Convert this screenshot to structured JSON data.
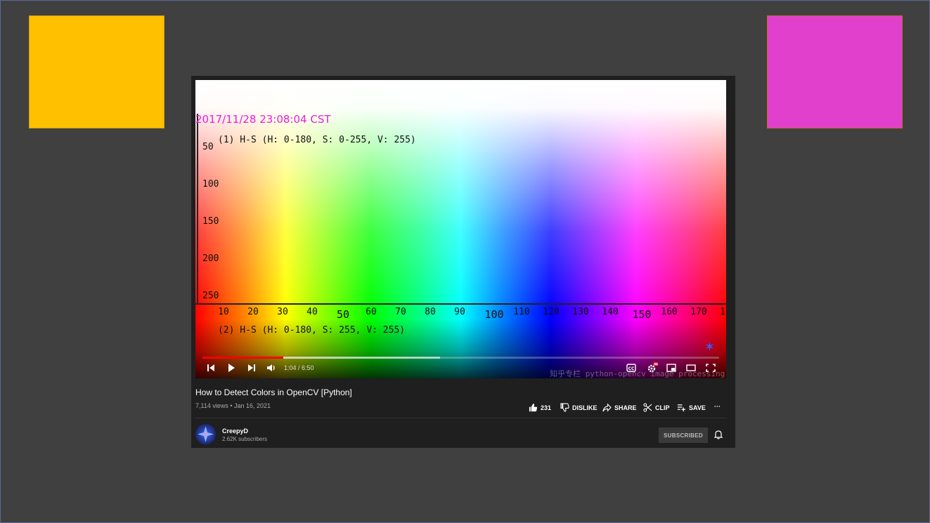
{
  "colors": {
    "swatch_left": "#ffc000",
    "swatch_right": "#e040cc",
    "page_bg": "#404040",
    "progress_played": "#ff0000"
  },
  "video": {
    "overlay": {
      "timestamp": "2017/11/28 23:08:04 CST",
      "hs_label_1": "(1) H-S (H: 0-180, S: 0-255, V: 255)",
      "hs_label_2": "(2) H-S (H: 0-180, S: 255, V: 255)",
      "y_ticks": [
        "50",
        "100",
        "150",
        "200",
        "250"
      ],
      "x_ticks": [
        "10",
        "20",
        "30",
        "40",
        "50",
        "60",
        "70",
        "80",
        "90",
        "100",
        "110",
        "120",
        "130",
        "140",
        "150",
        "160",
        "170",
        "1"
      ],
      "watermark": "知乎专栏 python-opencv image processing"
    },
    "player": {
      "time_display": "1:04 / 6:50",
      "played_fraction": 0.156,
      "buffered_fraction": 0.46,
      "icons": [
        "skip-previous-icon",
        "play-icon",
        "skip-next-icon",
        "volume-icon",
        "captions-icon",
        "settings-icon",
        "miniplayer-icon",
        "theater-icon",
        "fullscreen-icon"
      ],
      "cc_label": "CC",
      "hd_badge": "HD"
    },
    "title": "How to Detect Colors in OpenCV [Python]",
    "meta": "7,114 views • Jan 16, 2021",
    "actions": {
      "like_count": "231",
      "dislike_label": "DISLIKE",
      "share_label": "SHARE",
      "clip_label": "CLIP",
      "save_label": "SAVE",
      "more_label": "···"
    },
    "channel": {
      "name": "CreepyD",
      "subscribers": "2.62K subscribers",
      "subscribe_label": "SUBSCRIBED"
    }
  }
}
